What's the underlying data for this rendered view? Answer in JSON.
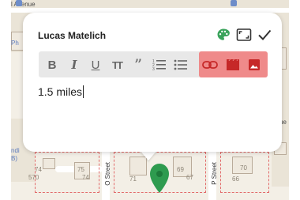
{
  "map": {
    "top_label": "l Avenue",
    "side_labels": [
      "Ph",
      "ndi",
      "B)",
      "ue"
    ],
    "street_left": "O Street",
    "street_right": "P Street",
    "lot_numbers": [
      "74",
      "75",
      "74",
      "69",
      "67",
      "570",
      "70",
      "71",
      "66"
    ]
  },
  "card": {
    "title": "Lucas Matelich",
    "header_icons": [
      "palette-icon",
      "expand-icon",
      "check-icon"
    ],
    "toolbar": [
      {
        "name": "bold",
        "icon": "bold-icon"
      },
      {
        "name": "italic",
        "icon": "italic-icon"
      },
      {
        "name": "underline",
        "icon": "underline-icon"
      },
      {
        "name": "text-size",
        "icon": "text-size-icon"
      },
      {
        "name": "quote",
        "icon": "quote-icon"
      },
      {
        "name": "numbered-list",
        "icon": "numbered-list-icon"
      },
      {
        "name": "bulleted-list",
        "icon": "bulleted-list-icon"
      },
      {
        "name": "link",
        "icon": "link-icon"
      },
      {
        "name": "video",
        "icon": "video-icon"
      },
      {
        "name": "image",
        "icon": "image-icon"
      }
    ],
    "content": "1.5 miles"
  },
  "colors": {
    "palette_icon": "#3aa35b",
    "toolbar_bg": "#e8e8e8",
    "highlight": "#ef8a8a",
    "media_icons": "#c62828",
    "marker": "#2e9b4f"
  }
}
